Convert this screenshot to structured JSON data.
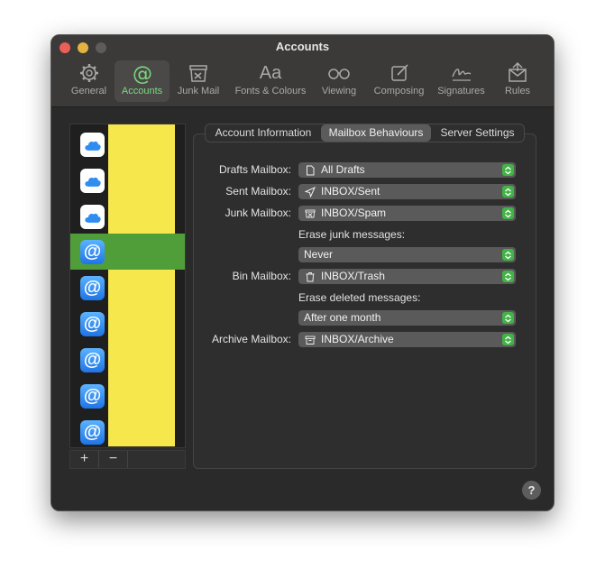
{
  "window": {
    "title": "Accounts"
  },
  "toolbar": {
    "items": [
      {
        "label": "General",
        "icon": "gear-icon"
      },
      {
        "label": "Accounts",
        "icon": "at-icon",
        "active": true
      },
      {
        "label": "Junk Mail",
        "icon": "junk-mail-icon"
      },
      {
        "label": "Fonts & Colours",
        "icon": "fonts-icon",
        "glyph": "Aa"
      },
      {
        "label": "Viewing",
        "icon": "glasses-icon"
      },
      {
        "label": "Composing",
        "icon": "compose-icon"
      },
      {
        "label": "Signatures",
        "icon": "signature-icon"
      },
      {
        "label": "Rules",
        "icon": "rules-icon"
      }
    ]
  },
  "accounts": {
    "items": [
      {
        "type": "icloud"
      },
      {
        "type": "icloud"
      },
      {
        "type": "icloud"
      },
      {
        "type": "mail",
        "selected": true
      },
      {
        "type": "mail"
      },
      {
        "type": "mail"
      },
      {
        "type": "mail"
      },
      {
        "type": "mail"
      },
      {
        "type": "mail"
      }
    ],
    "add_label": "+",
    "remove_label": "−",
    "at_glyph": "@"
  },
  "tabs": [
    {
      "label": "Account Information"
    },
    {
      "label": "Mailbox Behaviours",
      "active": true
    },
    {
      "label": "Server Settings"
    }
  ],
  "mailbox": {
    "drafts_label": "Drafts Mailbox:",
    "drafts_value": "All Drafts",
    "sent_label": "Sent Mailbox:",
    "sent_value": "INBOX/Sent",
    "junk_label": "Junk Mailbox:",
    "junk_value": "INBOX/Spam",
    "erase_junk_label": "Erase junk messages:",
    "erase_junk_value": "Never",
    "bin_label": "Bin Mailbox:",
    "bin_value": "INBOX/Trash",
    "erase_deleted_label": "Erase deleted messages:",
    "erase_deleted_value": "After one month",
    "archive_label": "Archive Mailbox:",
    "archive_value": "INBOX/Archive"
  },
  "help": {
    "label": "?"
  },
  "colors": {
    "accent": "#7bd97e",
    "selection": "#4f9e3a",
    "redacted": "#f6e84c",
    "stepper": "#43b347"
  }
}
